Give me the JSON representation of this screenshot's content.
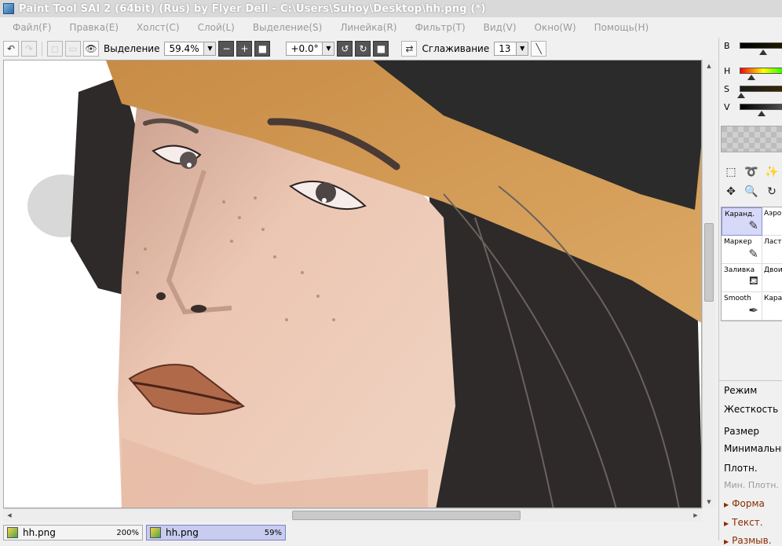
{
  "window": {
    "title": "Paint Tool SAI 2 (64bit) (Rus) by Flyer Dell - C:\\Users\\Suhoy\\Desktop\\hh.png (*)"
  },
  "menu": [
    "Файл(F)",
    "Правка(E)",
    "Холст(C)",
    "Слой(L)",
    "Выделение(S)",
    "Линейка(R)",
    "Фильтр(T)",
    "Вид(V)",
    "Окно(W)",
    "Помощь(H)"
  ],
  "toolbar": {
    "selection_label": "Выделение",
    "zoom": "59.4%",
    "rotation": "+0.0°",
    "smoothing_label": "Сглаживание",
    "smoothing_value": "13"
  },
  "colors": {
    "labels": [
      "B",
      "H",
      "S",
      "V"
    ],
    "hat": "#d5a35f",
    "hat_band": "#2b2b2b",
    "skin": "#ecc7b3",
    "hair": "#2d2a29",
    "lips": "#b06a4a",
    "accent_tab": "#c8ccef"
  },
  "tools": {
    "brushes": [
      {
        "name": "Каранд.",
        "icon": "pencil-icon"
      },
      {
        "name": "Аэро",
        "icon": "airbrush-icon"
      },
      {
        "name": "Маркер",
        "icon": "marker-icon"
      },
      {
        "name": "Ласт",
        "icon": "eraser-icon"
      },
      {
        "name": "Заливка",
        "icon": "bucket-icon"
      },
      {
        "name": "Двои",
        "icon": "binary-icon"
      },
      {
        "name": "Smooth",
        "icon": "smooth-brush-icon"
      },
      {
        "name": "Кара",
        "icon": "pencil2-icon"
      }
    ]
  },
  "properties": {
    "mode": "Режим",
    "hardness": "Жесткость",
    "size": "Размер",
    "min_size": "Минимальный",
    "density": "Плотн.",
    "min_density": "Мин. Плотн.",
    "shape": "Форма",
    "texture": "Текст.",
    "blend": "Размыв."
  },
  "tabs": [
    {
      "name": "hh.png",
      "zoom": "200%"
    },
    {
      "name": "hh.png",
      "zoom": "59%"
    }
  ]
}
